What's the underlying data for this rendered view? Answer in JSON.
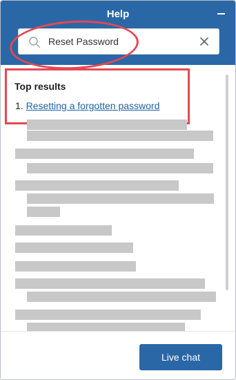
{
  "header": {
    "title": "Help",
    "minimize_icon": "minus-icon",
    "background": "#2a67a6"
  },
  "search": {
    "value": "Reset Password",
    "search_icon": "search-icon",
    "clear_icon": "close-icon"
  },
  "results": {
    "heading": "Top results",
    "items": [
      {
        "number": "1.",
        "label": "Resetting a forgotten password"
      }
    ]
  },
  "footer": {
    "live_chat_label": "Live chat"
  },
  "colors": {
    "accent": "#2a67a6",
    "highlight": "#e64753",
    "link": "#1f62a5",
    "placeholder_bar": "#c8c8c8"
  }
}
